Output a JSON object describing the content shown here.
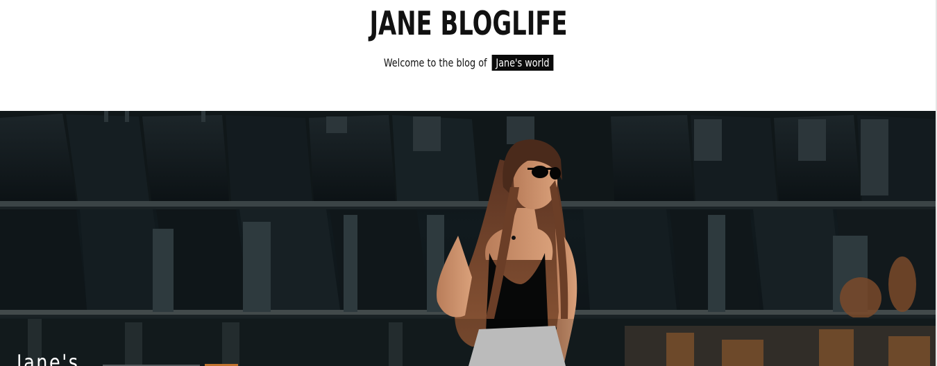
{
  "site": {
    "title": "JANE BLOGLIFE",
    "tagline_prefix": "Welcome to the blog of",
    "tagline_highlight": "Jane's world"
  },
  "hero": {
    "image_description_icon": "hero-photo-icon",
    "caption": "Jane's"
  },
  "colors": {
    "highlight_bg": "#0a0a0a",
    "accent": "#c1732e",
    "hero_bg": "#0d1316"
  }
}
